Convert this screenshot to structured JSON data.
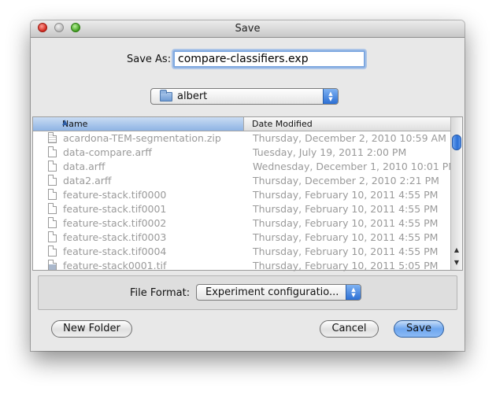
{
  "window": {
    "title": "Save"
  },
  "save_as": {
    "label": "Save As:",
    "value": "compare-classifiers.exp"
  },
  "location": {
    "folder": "albert"
  },
  "file_list": {
    "columns": {
      "name": "Name",
      "date": "Date Modified"
    },
    "rows": [
      {
        "name": "acardona-TEM-segmentation.zip",
        "date": "Thursday, December 2, 2010 10:59 AM",
        "icon": "zip-file-icon"
      },
      {
        "name": "data-compare.arff",
        "date": "Tuesday, July 19, 2011 2:00 PM",
        "icon": "document-icon"
      },
      {
        "name": "data.arff",
        "date": "Wednesday, December 1, 2010 10:01 PM",
        "icon": "document-icon"
      },
      {
        "name": "data2.arff",
        "date": "Thursday, December 2, 2010 2:21 PM",
        "icon": "document-icon"
      },
      {
        "name": "feature-stack.tif0000",
        "date": "Thursday, February 10, 2011 4:55 PM",
        "icon": "document-icon"
      },
      {
        "name": "feature-stack.tif0001",
        "date": "Thursday, February 10, 2011 4:55 PM",
        "icon": "document-icon"
      },
      {
        "name": "feature-stack.tif0002",
        "date": "Thursday, February 10, 2011 4:55 PM",
        "icon": "document-icon"
      },
      {
        "name": "feature-stack.tif0003",
        "date": "Thursday, February 10, 2011 4:55 PM",
        "icon": "document-icon"
      },
      {
        "name": "feature-stack.tif0004",
        "date": "Thursday, February 10, 2011 4:55 PM",
        "icon": "document-icon"
      },
      {
        "name": "feature-stack0001.tif",
        "date": "Thursday, February 10, 2011 5:05 PM",
        "icon": "image-file-icon"
      }
    ]
  },
  "file_format": {
    "label": "File Format:",
    "value": "Experiment configuratio..."
  },
  "buttons": {
    "new_folder": "New Folder",
    "cancel": "Cancel",
    "save": "Save"
  }
}
